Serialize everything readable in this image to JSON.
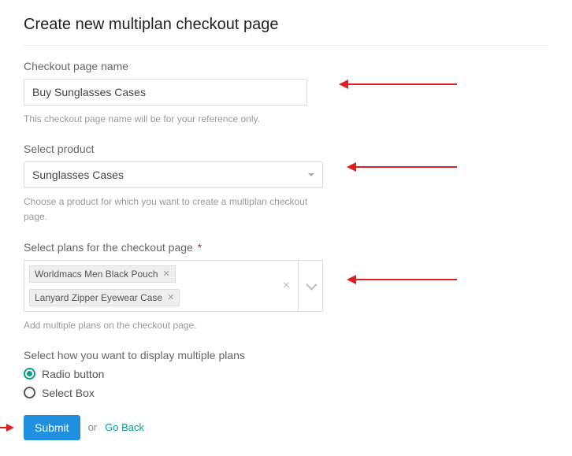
{
  "title": "Create new multiplan checkout page",
  "fields": {
    "name": {
      "label": "Checkout page name",
      "value": "Buy Sunglasses Cases",
      "helper": "This checkout page name will be for your reference only."
    },
    "product": {
      "label": "Select product",
      "value": "Sunglasses Cases",
      "helper": "Choose a product for which you want to create a multiplan checkout page."
    },
    "plans": {
      "label": "Select plans for the checkout page",
      "required_mark": "*",
      "selected": [
        "Worldmacs Men Black Pouch",
        "Lanyard Zipper Eyewear Case"
      ],
      "helper": "Add multiple plans on the checkout page."
    },
    "display": {
      "label": "Select how you want to display multiple plans",
      "options": [
        {
          "label": "Radio button",
          "checked": true
        },
        {
          "label": "Select Box",
          "checked": false
        }
      ]
    }
  },
  "actions": {
    "submit": "Submit",
    "or": "or",
    "go_back": "Go Back"
  },
  "annotations": {
    "arrow_color": "#e02020"
  }
}
